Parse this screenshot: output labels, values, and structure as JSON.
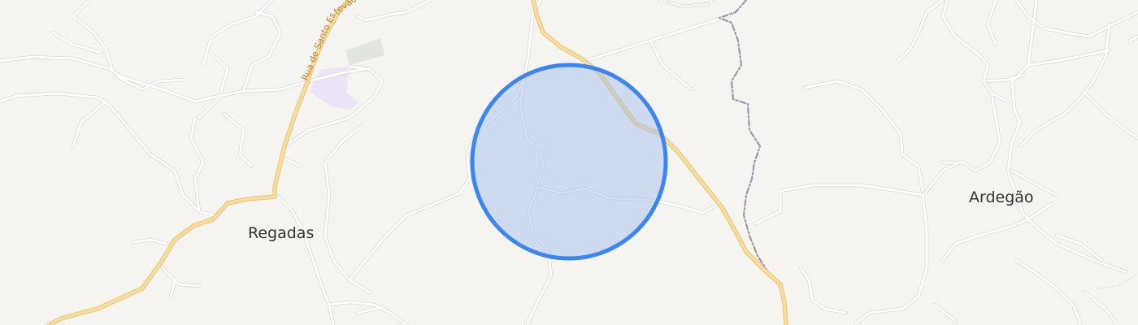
{
  "colors": {
    "background": "#f6f4f1",
    "minor_road": "#ffffff",
    "minor_road_casing": "#dddbd8",
    "main_road": "#f7dc9a",
    "main_road_casing": "#e7c87e",
    "boundary": "#9b98a8",
    "circle_fill": "#9cbbee",
    "circle_stroke": "#3b86ef",
    "park_area": "#e2e5df",
    "landuse_lilac": "#ece4f6",
    "road_label": "#b9843a",
    "place_label": "#333333"
  },
  "places": {
    "regadas": "Regadas",
    "ardegao": "Ardegão"
  },
  "roads": {
    "main_road_name": "Rua de Santo Estevão"
  },
  "highlight": {
    "shape": "circle"
  },
  "icons": {
    "location_marker": "accuracy-circle"
  }
}
